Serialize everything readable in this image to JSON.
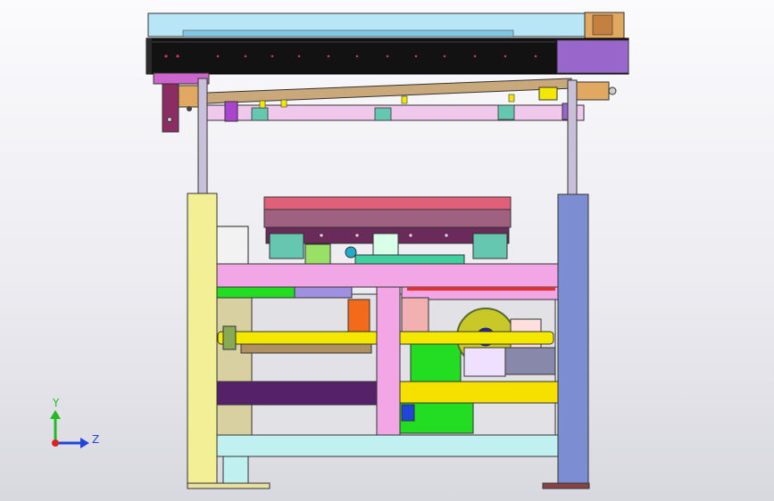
{
  "viewport": {
    "view": "cad-3d-assembly",
    "colors": {
      "background_top": "#fbfbfd",
      "background_bottom": "#d8d8df",
      "beam": "#121212",
      "accent_purple": "#9966cc",
      "upright_left": "#f2ef96",
      "upright_right": "#7c8dd1",
      "pink_frame": "#f2a6e6",
      "yellow_shaft": "#f5e800",
      "green_block": "#22dd22",
      "orange_part": "#f26a1a"
    }
  },
  "triad": {
    "y_label": "Y",
    "z_label": "Z",
    "y_color": "#22bb22",
    "z_color": "#2244dd",
    "x_color": "#dd2222"
  }
}
